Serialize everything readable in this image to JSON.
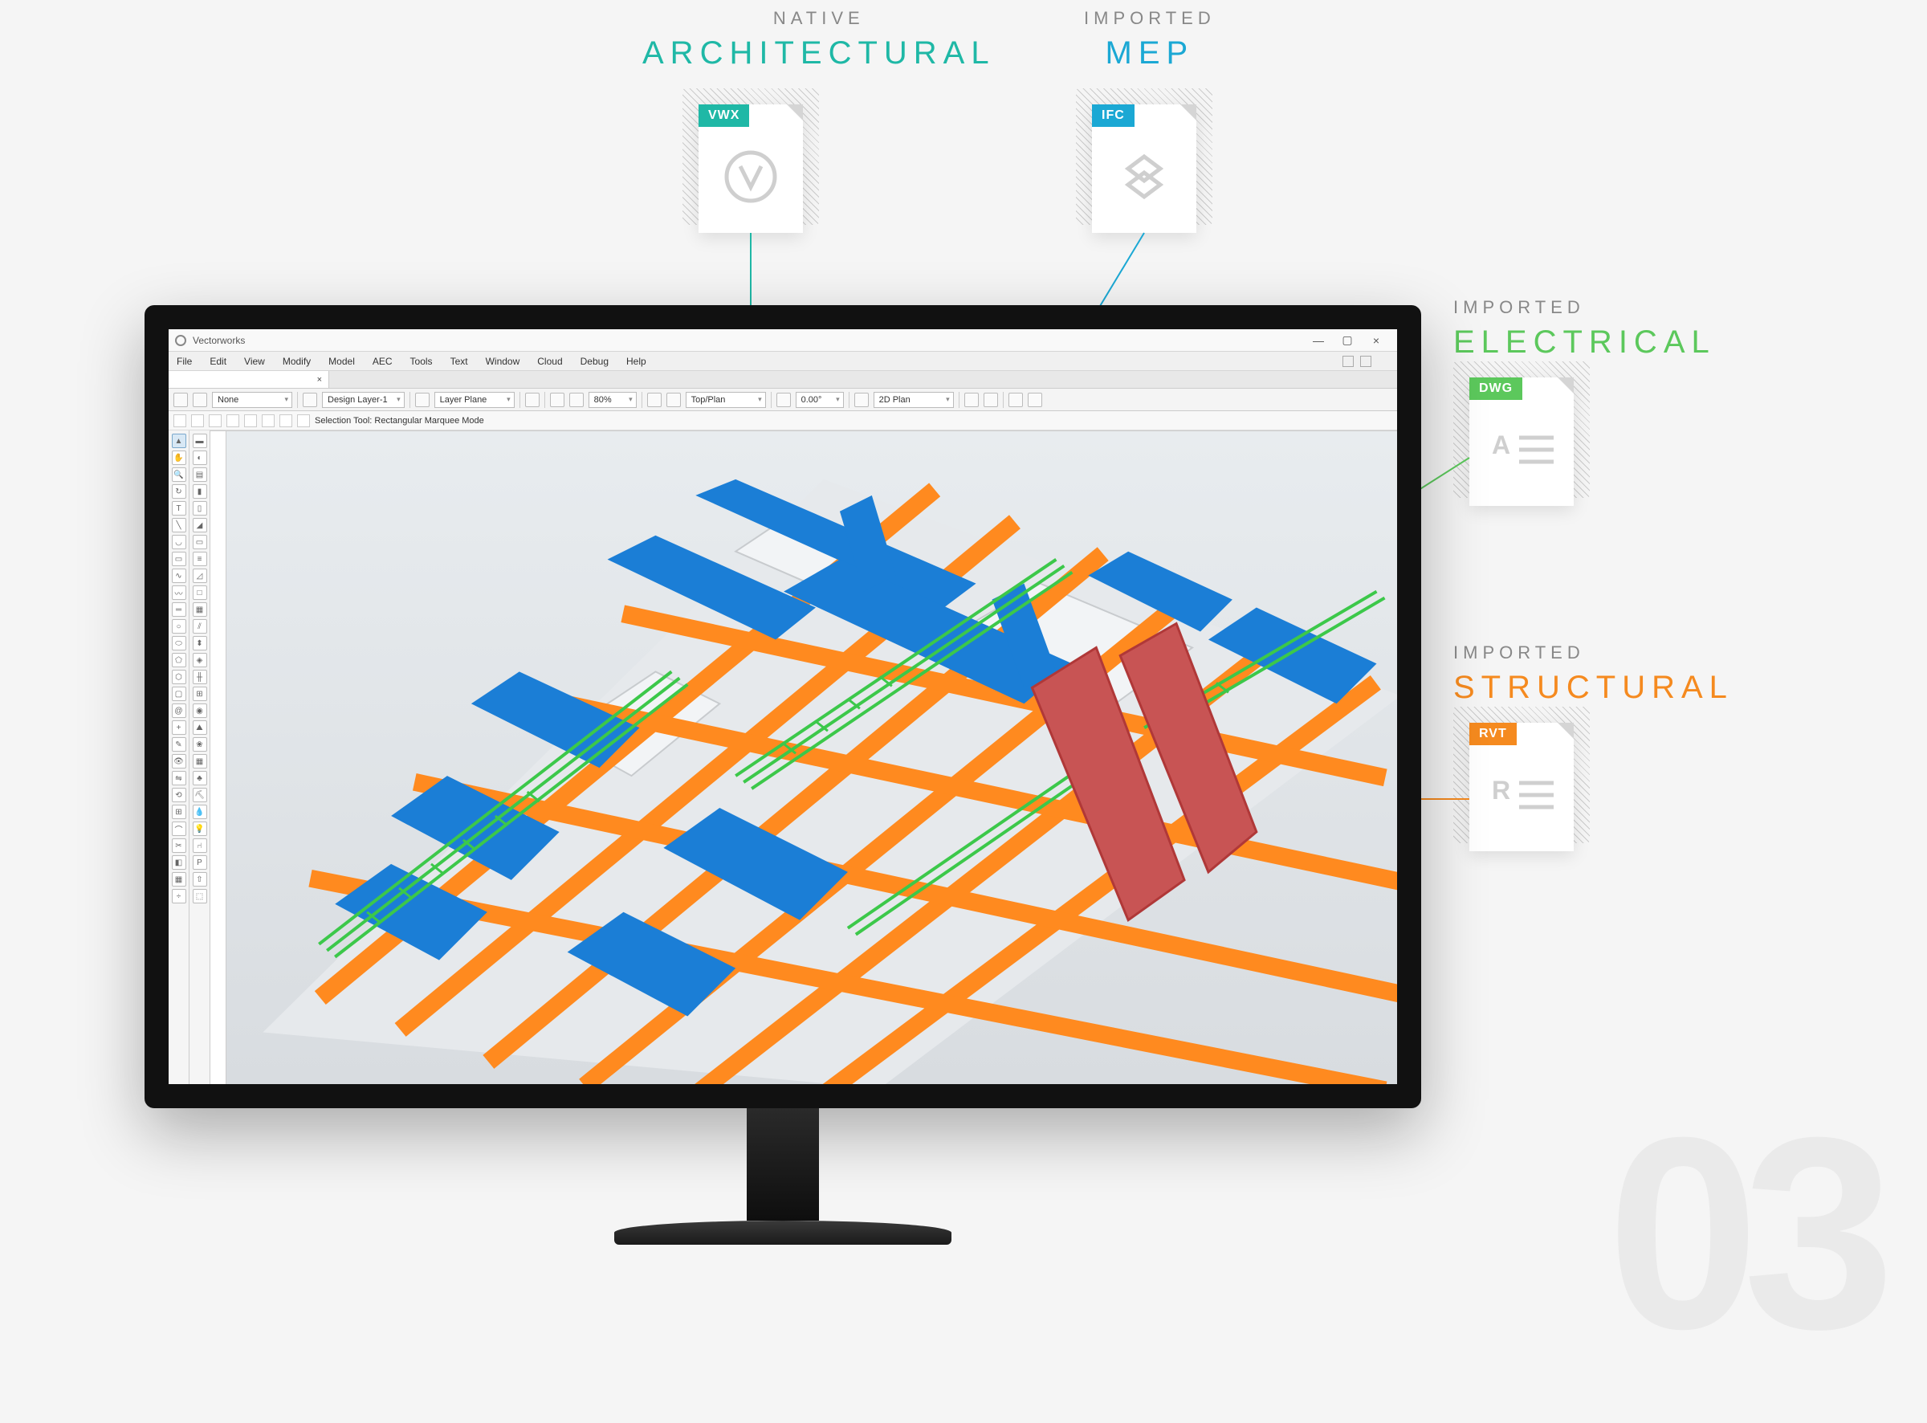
{
  "page_number": "03",
  "callouts": {
    "arch": {
      "sub": "NATIVE",
      "main": "ARCHITECTURAL"
    },
    "mep": {
      "sub": "IMPORTED",
      "main": "MEP"
    },
    "elec": {
      "sub": "IMPORTED",
      "main": "ELECTRICAL"
    },
    "struct": {
      "sub": "IMPORTED",
      "main": "STRUCTURAL"
    }
  },
  "files": {
    "vwx": {
      "tag": "VWX"
    },
    "ifc": {
      "tag": "IFC"
    },
    "dwg": {
      "tag": "DWG"
    },
    "rvt": {
      "tag": "RVT"
    }
  },
  "app": {
    "title": "Vectorworks",
    "menu": [
      "File",
      "Edit",
      "View",
      "Modify",
      "Model",
      "AEC",
      "Tools",
      "Text",
      "Window",
      "Cloud",
      "Debug",
      "Help"
    ],
    "tab_close": "×",
    "window_buttons": {
      "min": "—",
      "max": "▢",
      "close": "×"
    }
  },
  "options": {
    "class": "None",
    "layer": "Design Layer-1",
    "plane": "Layer Plane",
    "zoom": "80%",
    "view": "Top/Plan",
    "angle": "0.00°",
    "render": "2D Plan"
  },
  "statusbar": {
    "tool": "Selection Tool: Rectangular Marquee Mode"
  },
  "colors": {
    "arch": "#1fb8a6",
    "mep": "#1ba8d4",
    "elec": "#5cc85c",
    "struct": "#f58a1f",
    "duct": "#1b7ed6",
    "beam": "#ff8a1f",
    "cable": "#3cc84a"
  }
}
